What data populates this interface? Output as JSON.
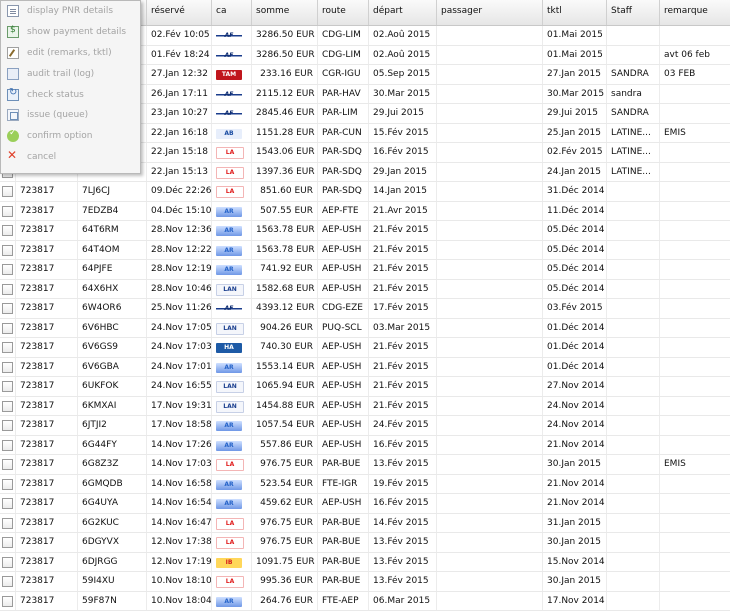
{
  "context_menu": {
    "items": [
      {
        "label": "display PNR details",
        "icon": "document-icon",
        "enabled": false
      },
      {
        "label": "show payment details",
        "icon": "payment-icon",
        "enabled": false
      },
      {
        "label": "edit (remarks, tktl)",
        "icon": "edit-icon",
        "enabled": false
      },
      {
        "label": "audit trail (log)",
        "icon": "log-icon",
        "enabled": false
      },
      {
        "label": "check status",
        "icon": "refresh-icon",
        "enabled": false
      },
      {
        "label": "issue (queue)",
        "icon": "queue-icon",
        "enabled": false
      },
      {
        "label": "confirm option",
        "icon": "check-circle-icon",
        "enabled": false
      },
      {
        "label": "cancel",
        "icon": "cancel-x-icon",
        "enabled": false
      }
    ]
  },
  "table": {
    "headers": [
      "",
      "",
      "",
      "réservé",
      "ca",
      "somme",
      "route",
      "départ",
      "passager",
      "tktl",
      "Staff",
      "remarque"
    ],
    "rows": [
      {
        "agent": "",
        "pnr": "",
        "reserve": "02.Fév 10:05",
        "ca": "AF",
        "somme": "3286.50 EUR",
        "route": "CDG-LIM",
        "depart": "02.Aoû 2015",
        "tktl": "01.Mai 2015",
        "staff": "",
        "remarque": ""
      },
      {
        "agent": "",
        "pnr": "",
        "reserve": "01.Fév 18:24",
        "ca": "AF",
        "somme": "3286.50 EUR",
        "route": "CDG-LIM",
        "depart": "02.Aoû 2015",
        "tktl": "01.Mai 2015",
        "staff": "",
        "remarque": "avt 06 feb"
      },
      {
        "agent": "",
        "pnr": "",
        "reserve": "27.Jan 12:32",
        "ca": "TAM",
        "somme": "233.16 EUR",
        "route": "CGR-IGU",
        "depart": "05.Sep 2015",
        "tktl": "27.Jan 2015",
        "staff": "SANDRA",
        "remarque": "03 FEB"
      },
      {
        "agent": "",
        "pnr": "",
        "reserve": "26.Jan 17:11",
        "ca": "AF",
        "somme": "2115.12 EUR",
        "route": "PAR-HAV",
        "depart": "30.Mar 2015",
        "tktl": "30.Mar 2015",
        "staff": "sandra",
        "remarque": ""
      },
      {
        "agent": "",
        "pnr": "",
        "reserve": "23.Jan 10:27",
        "ca": "AF",
        "somme": "2845.46 EUR",
        "route": "PAR-LIM",
        "depart": "29.Jui 2015",
        "tktl": "29.Jui 2015",
        "staff": "SANDRA",
        "remarque": ""
      },
      {
        "agent": "",
        "pnr": "",
        "reserve": "22.Jan 16:18",
        "ca": "AB",
        "somme": "1151.28 EUR",
        "route": "PAR-CUN",
        "depart": "15.Fév 2015",
        "tktl": "25.Jan 2015",
        "staff": "LATINE...",
        "remarque": "EMIS"
      },
      {
        "agent": "",
        "pnr": "",
        "reserve": "22.Jan 15:18",
        "ca": "LAT",
        "somme": "1543.06 EUR",
        "route": "PAR-SDQ",
        "depart": "16.Fév 2015",
        "tktl": "02.Fév 2015",
        "staff": "LATINE...",
        "remarque": ""
      },
      {
        "agent": "",
        "pnr": "",
        "reserve": "22.Jan 15:13",
        "ca": "LAT",
        "somme": "1397.36 EUR",
        "route": "PAR-SDQ",
        "depart": "29.Jan 2015",
        "tktl": "24.Jan 2015",
        "staff": "LATINE...",
        "remarque": ""
      },
      {
        "agent": "723817",
        "pnr": "7LJ6CJ",
        "reserve": "09.Déc 22:26",
        "ca": "LAT",
        "somme": "851.60 EUR",
        "route": "PAR-SDQ",
        "depart": "14.Jan 2015",
        "tktl": "31.Déc 2014",
        "staff": "",
        "remarque": ""
      },
      {
        "agent": "723817",
        "pnr": "7EDZB4",
        "reserve": "04.Déc 15:10",
        "ca": "AR",
        "somme": "507.55 EUR",
        "route": "AEP-FTE",
        "depart": "21.Avr 2015",
        "tktl": "11.Déc 2014",
        "staff": "",
        "remarque": ""
      },
      {
        "agent": "723817",
        "pnr": "64T6RM",
        "reserve": "28.Nov 12:36",
        "ca": "AR",
        "somme": "1563.78 EUR",
        "route": "AEP-USH",
        "depart": "21.Fév 2015",
        "tktl": "05.Déc 2014",
        "staff": "",
        "remarque": ""
      },
      {
        "agent": "723817",
        "pnr": "64T4OM",
        "reserve": "28.Nov 12:22",
        "ca": "AR",
        "somme": "1563.78 EUR",
        "route": "AEP-USH",
        "depart": "21.Fév 2015",
        "tktl": "05.Déc 2014",
        "staff": "",
        "remarque": ""
      },
      {
        "agent": "723817",
        "pnr": "64PJFE",
        "reserve": "28.Nov 12:19",
        "ca": "AR",
        "somme": "741.92 EUR",
        "route": "AEP-USH",
        "depart": "21.Fév 2015",
        "tktl": "05.Déc 2014",
        "staff": "",
        "remarque": ""
      },
      {
        "agent": "723817",
        "pnr": "64X6HX",
        "reserve": "28.Nov 10:46",
        "ca": "LAN",
        "somme": "1582.68 EUR",
        "route": "AEP-USH",
        "depart": "21.Fév 2015",
        "tktl": "05.Déc 2014",
        "staff": "",
        "remarque": ""
      },
      {
        "agent": "723817",
        "pnr": "6W4OR6",
        "reserve": "25.Nov 11:26",
        "ca": "AF",
        "somme": "4393.12 EUR",
        "route": "CDG-EZE",
        "depart": "17.Fév 2015",
        "tktl": "03.Fév 2015",
        "staff": "",
        "remarque": ""
      },
      {
        "agent": "723817",
        "pnr": "6V6HBC",
        "reserve": "24.Nov 17:05",
        "ca": "LAN",
        "somme": "904.26 EUR",
        "route": "PUQ-SCL",
        "depart": "03.Mar 2015",
        "tktl": "01.Déc 2014",
        "staff": "",
        "remarque": ""
      },
      {
        "agent": "723817",
        "pnr": "6V6GS9",
        "reserve": "24.Nov 17:03",
        "ca": "HA",
        "somme": "740.30 EUR",
        "route": "AEP-USH",
        "depart": "21.Fév 2015",
        "tktl": "01.Déc 2014",
        "staff": "",
        "remarque": ""
      },
      {
        "agent": "723817",
        "pnr": "6V6GBA",
        "reserve": "24.Nov 17:01",
        "ca": "AR",
        "somme": "1553.14 EUR",
        "route": "AEP-USH",
        "depart": "21.Fév 2015",
        "tktl": "01.Déc 2014",
        "staff": "",
        "remarque": ""
      },
      {
        "agent": "723817",
        "pnr": "6UKFOK",
        "reserve": "24.Nov 16:55",
        "ca": "LAN",
        "somme": "1065.94 EUR",
        "route": "AEP-USH",
        "depart": "21.Fév 2015",
        "tktl": "27.Nov 2014",
        "staff": "",
        "remarque": ""
      },
      {
        "agent": "723817",
        "pnr": "6KMXAI",
        "reserve": "17.Nov 19:31",
        "ca": "LAN",
        "somme": "1454.88 EUR",
        "route": "AEP-USH",
        "depart": "21.Fév 2015",
        "tktl": "24.Nov 2014",
        "staff": "",
        "remarque": ""
      },
      {
        "agent": "723817",
        "pnr": "6JTJI2",
        "reserve": "17.Nov 18:58",
        "ca": "AR",
        "somme": "1057.54 EUR",
        "route": "AEP-USH",
        "depart": "24.Fév 2015",
        "tktl": "24.Nov 2014",
        "staff": "",
        "remarque": ""
      },
      {
        "agent": "723817",
        "pnr": "6G44FY",
        "reserve": "14.Nov 17:26",
        "ca": "AR",
        "somme": "557.86 EUR",
        "route": "AEP-USH",
        "depart": "16.Fév 2015",
        "tktl": "21.Nov 2014",
        "staff": "",
        "remarque": ""
      },
      {
        "agent": "723817",
        "pnr": "6G8Z3Z",
        "reserve": "14.Nov 17:03",
        "ca": "LAT",
        "somme": "976.75 EUR",
        "route": "PAR-BUE",
        "depart": "13.Fév 2015",
        "tktl": "30.Jan 2015",
        "staff": "",
        "remarque": "EMIS"
      },
      {
        "agent": "723817",
        "pnr": "6GMQDB",
        "reserve": "14.Nov 16:58",
        "ca": "AR",
        "somme": "523.54 EUR",
        "route": "FTE-IGR",
        "depart": "19.Fév 2015",
        "tktl": "21.Nov 2014",
        "staff": "",
        "remarque": ""
      },
      {
        "agent": "723817",
        "pnr": "6G4UYA",
        "reserve": "14.Nov 16:54",
        "ca": "AR",
        "somme": "459.62 EUR",
        "route": "AEP-USH",
        "depart": "16.Fév 2015",
        "tktl": "21.Nov 2014",
        "staff": "",
        "remarque": ""
      },
      {
        "agent": "723817",
        "pnr": "6G2KUC",
        "reserve": "14.Nov 16:47",
        "ca": "LAT",
        "somme": "976.75 EUR",
        "route": "PAR-BUE",
        "depart": "14.Fév 2015",
        "tktl": "31.Jan 2015",
        "staff": "",
        "remarque": ""
      },
      {
        "agent": "723817",
        "pnr": "6DGYVX",
        "reserve": "12.Nov 17:38",
        "ca": "LAT",
        "somme": "976.75 EUR",
        "route": "PAR-BUE",
        "depart": "13.Fév 2015",
        "tktl": "30.Jan 2015",
        "staff": "",
        "remarque": ""
      },
      {
        "agent": "723817",
        "pnr": "6DJRGG",
        "reserve": "12.Nov 17:19",
        "ca": "IBR",
        "somme": "1091.75 EUR",
        "route": "PAR-BUE",
        "depart": "13.Fév 2015",
        "tktl": "15.Nov 2014",
        "staff": "",
        "remarque": ""
      },
      {
        "agent": "723817",
        "pnr": "59I4XU",
        "reserve": "10.Nov 18:10",
        "ca": "LAT",
        "somme": "995.36 EUR",
        "route": "PAR-BUE",
        "depart": "13.Fév 2015",
        "tktl": "30.Jan 2015",
        "staff": "",
        "remarque": ""
      },
      {
        "agent": "723817",
        "pnr": "59F87N",
        "reserve": "10.Nov 18:04",
        "ca": "AR",
        "somme": "264.76 EUR",
        "route": "FTE-AEP",
        "depart": "06.Mar 2015",
        "tktl": "17.Nov 2014",
        "staff": "",
        "remarque": ""
      }
    ]
  }
}
